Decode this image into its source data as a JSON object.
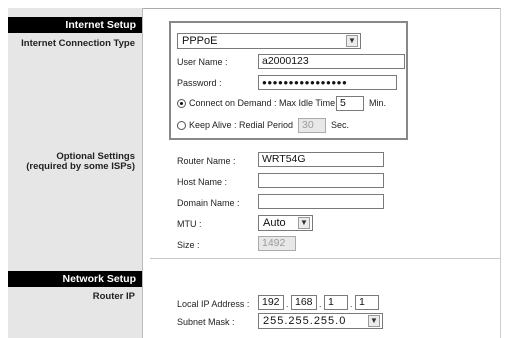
{
  "sections": {
    "internet_setup": "Internet Setup",
    "connection_type_label": "Internet Connection Type",
    "optional_settings_line1": "Optional Settings",
    "optional_settings_line2": "(required by some ISPs)",
    "network_setup": "Network Setup",
    "router_ip_label": "Router IP"
  },
  "pppoe": {
    "connection_type": "PPPoE",
    "username_label": "User Name :",
    "username_value": "a2000123",
    "password_label": "Password :",
    "password_value": "●●●●●●●●●●●●●●●●",
    "connect_on_demand_label": "Connect on Demand : Max Idle Time",
    "max_idle_time": "5",
    "min_label": "Min.",
    "keep_alive_label": "Keep Alive : Redial Period",
    "redial_period": "30",
    "sec_label": "Sec.",
    "selected_mode": "connect_on_demand"
  },
  "optional": {
    "router_name_label": "Router Name :",
    "router_name_value": "WRT54G",
    "host_name_label": "Host Name :",
    "host_name_value": "",
    "domain_name_label": "Domain Name :",
    "domain_name_value": "",
    "mtu_label": "MTU :",
    "mtu_value": "Auto",
    "size_label": "Size :",
    "size_value": "1492"
  },
  "network": {
    "local_ip_label": "Local IP Address :",
    "ip_octets": [
      "192",
      "168",
      "1",
      "1"
    ],
    "subnet_mask_label": "Subnet Mask :",
    "subnet_mask_value": "255.255.255.0"
  },
  "icons": {
    "dropdown": "chevron-down-icon",
    "radio": "radio-icon"
  },
  "colors": {
    "section_header_bg": "#000000",
    "sidebar_bg": "#e6e6e6",
    "box_border": "#888888"
  }
}
